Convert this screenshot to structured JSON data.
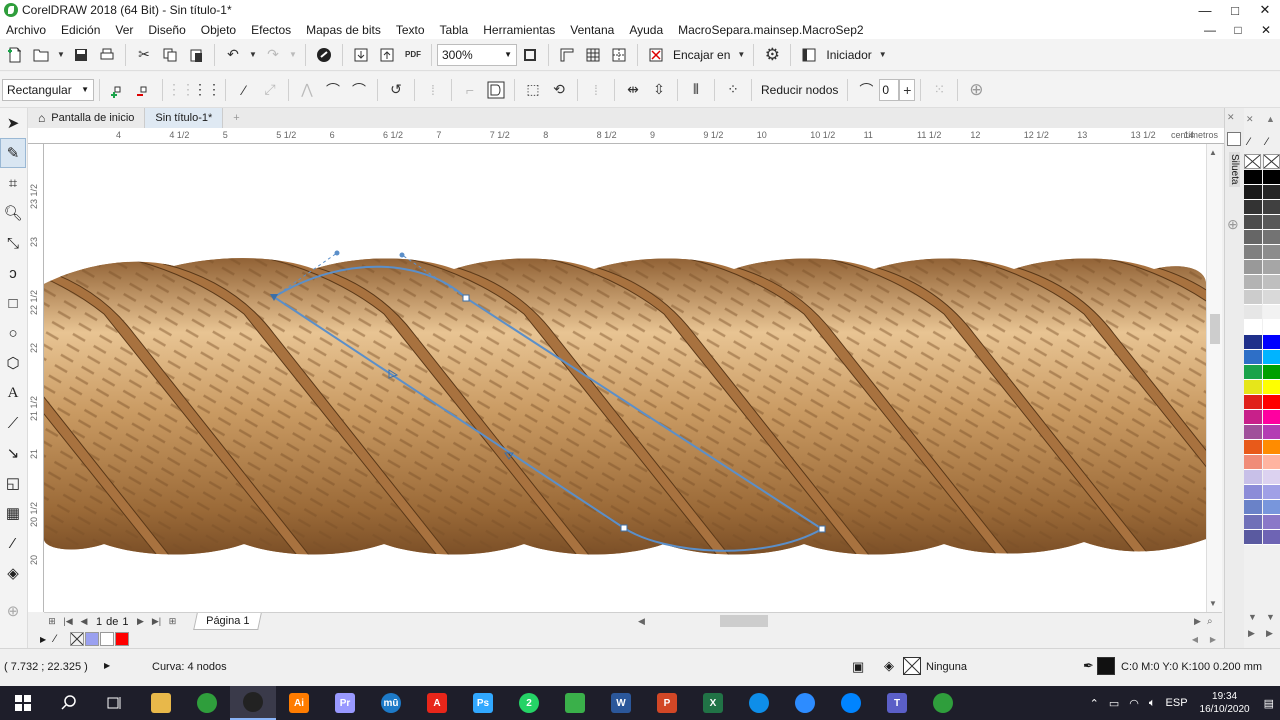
{
  "window": {
    "title": "CorelDRAW 2018 (64 Bit) - Sin título-1*",
    "buttons": [
      "—",
      "□",
      "✕"
    ]
  },
  "menu": {
    "items": [
      "Archivo",
      "Edición",
      "Ver",
      "Diseño",
      "Objeto",
      "Efectos",
      "Mapas de bits",
      "Texto",
      "Tabla",
      "Herramientas",
      "Ventana",
      "Ayuda",
      "MacroSepara.mainsep.MacroSep2"
    ]
  },
  "toolbar1": {
    "zoom": "300%",
    "snap_label": "Encajar en",
    "workspace_label": "Iniciador"
  },
  "toolbar2": {
    "selection_mode": "Rectangular",
    "reduce_nodes_label": "Reducir nodos",
    "curve_smoothness": "0"
  },
  "tabs": {
    "home": "Pantalla de inicio",
    "doc": "Sin título-1*",
    "add": "+"
  },
  "ruler": {
    "h_labels": [
      "4",
      "4 1/2",
      "5",
      "5 1/2",
      "6",
      "6 1/2",
      "7",
      "7 1/2",
      "8",
      "8 1/2",
      "9",
      "9 1/2",
      "10",
      "10 1/2",
      "11",
      "11 1/2",
      "12",
      "12 1/2",
      "13",
      "13 1/2",
      "14"
    ],
    "units": "centímetros",
    "v_labels": [
      "23 1/2",
      "23",
      "22 1/2",
      "22",
      "21 1/2",
      "21",
      "20 1/2",
      "20"
    ]
  },
  "pagebar": {
    "current": "1",
    "of": "de",
    "total": "1",
    "page_tab": "Página 1"
  },
  "status": {
    "coords": "( 7.732 ; 22.325 )",
    "object_info": "Curva: 4 nodos",
    "fill": "Ninguna",
    "outline": "C:0 M:0 Y:0 K:100  0.200 mm"
  },
  "docker": {
    "label": "Silueta"
  },
  "palette": {
    "col1": [
      "#000000",
      "#1a1a1a",
      "#333333",
      "#4d4d4d",
      "#666666",
      "#808080",
      "#999999",
      "#b3b3b3",
      "#cccccc",
      "#e6e6e6",
      "#ffffff",
      "#1f2f8a",
      "#2e6fc7",
      "#1aa34a",
      "#e6e61a",
      "#e0201a",
      "#c8208a",
      "#a0509a",
      "#e85a1a",
      "#f08c78",
      "#c8c0e8",
      "#8c8cd8",
      "#6a82c8",
      "#7070b8",
      "#5a5aa0"
    ],
    "col2": [
      "#000000",
      "#262626",
      "#404040",
      "#595959",
      "#737373",
      "#8c8c8c",
      "#a6a6a6",
      "#bfbfbf",
      "#d9d9d9",
      "#f2f2f2",
      "#ffffff",
      "#0000ff",
      "#00b4ff",
      "#00a000",
      "#ffff00",
      "#ff0000",
      "#ff00a0",
      "#b43cb4",
      "#ff8c00",
      "#ffb4a0",
      "#dcd2f0",
      "#a0a0e6",
      "#7896dc",
      "#8a78c8",
      "#6e64b4"
    ]
  },
  "swatches": [
    "none",
    "#9aa0f0",
    "#ffffff",
    "#ff0000"
  ],
  "taskbar": {
    "apps": [
      {
        "name": "explorer",
        "label": "",
        "color": "#e8b84a"
      },
      {
        "name": "chrome",
        "label": "",
        "color": "#2f9e3c"
      },
      {
        "name": "coreldraw",
        "label": "",
        "color": "#222222"
      },
      {
        "name": "illustrator",
        "label": "Ai",
        "color": "#ff7c00"
      },
      {
        "name": "premiere",
        "label": "Pr",
        "color": "#9999ff"
      },
      {
        "name": "musescore",
        "label": "mū",
        "color": "#1d7ac8"
      },
      {
        "name": "acrobat",
        "label": "A",
        "color": "#e8261a"
      },
      {
        "name": "photoshop",
        "label": "Ps",
        "color": "#31a8ff"
      },
      {
        "name": "whatsapp",
        "label": "2",
        "color": "#25d366"
      },
      {
        "name": "corel-green",
        "label": "",
        "color": "#3ab04a"
      },
      {
        "name": "word",
        "label": "W",
        "color": "#2b579a"
      },
      {
        "name": "powerpoint",
        "label": "P",
        "color": "#d24726"
      },
      {
        "name": "excel",
        "label": "X",
        "color": "#217346"
      },
      {
        "name": "teamviewer",
        "label": "",
        "color": "#0e8ee9"
      },
      {
        "name": "zoom",
        "label": "",
        "color": "#2d8cff"
      },
      {
        "name": "messenger",
        "label": "",
        "color": "#0084ff"
      },
      {
        "name": "teams",
        "label": "T",
        "color": "#5b5fc7"
      },
      {
        "name": "chrome2",
        "label": "",
        "color": "#2f9e3c"
      }
    ],
    "lang": "ESP",
    "time": "19:34",
    "date": "16/10/2020"
  }
}
